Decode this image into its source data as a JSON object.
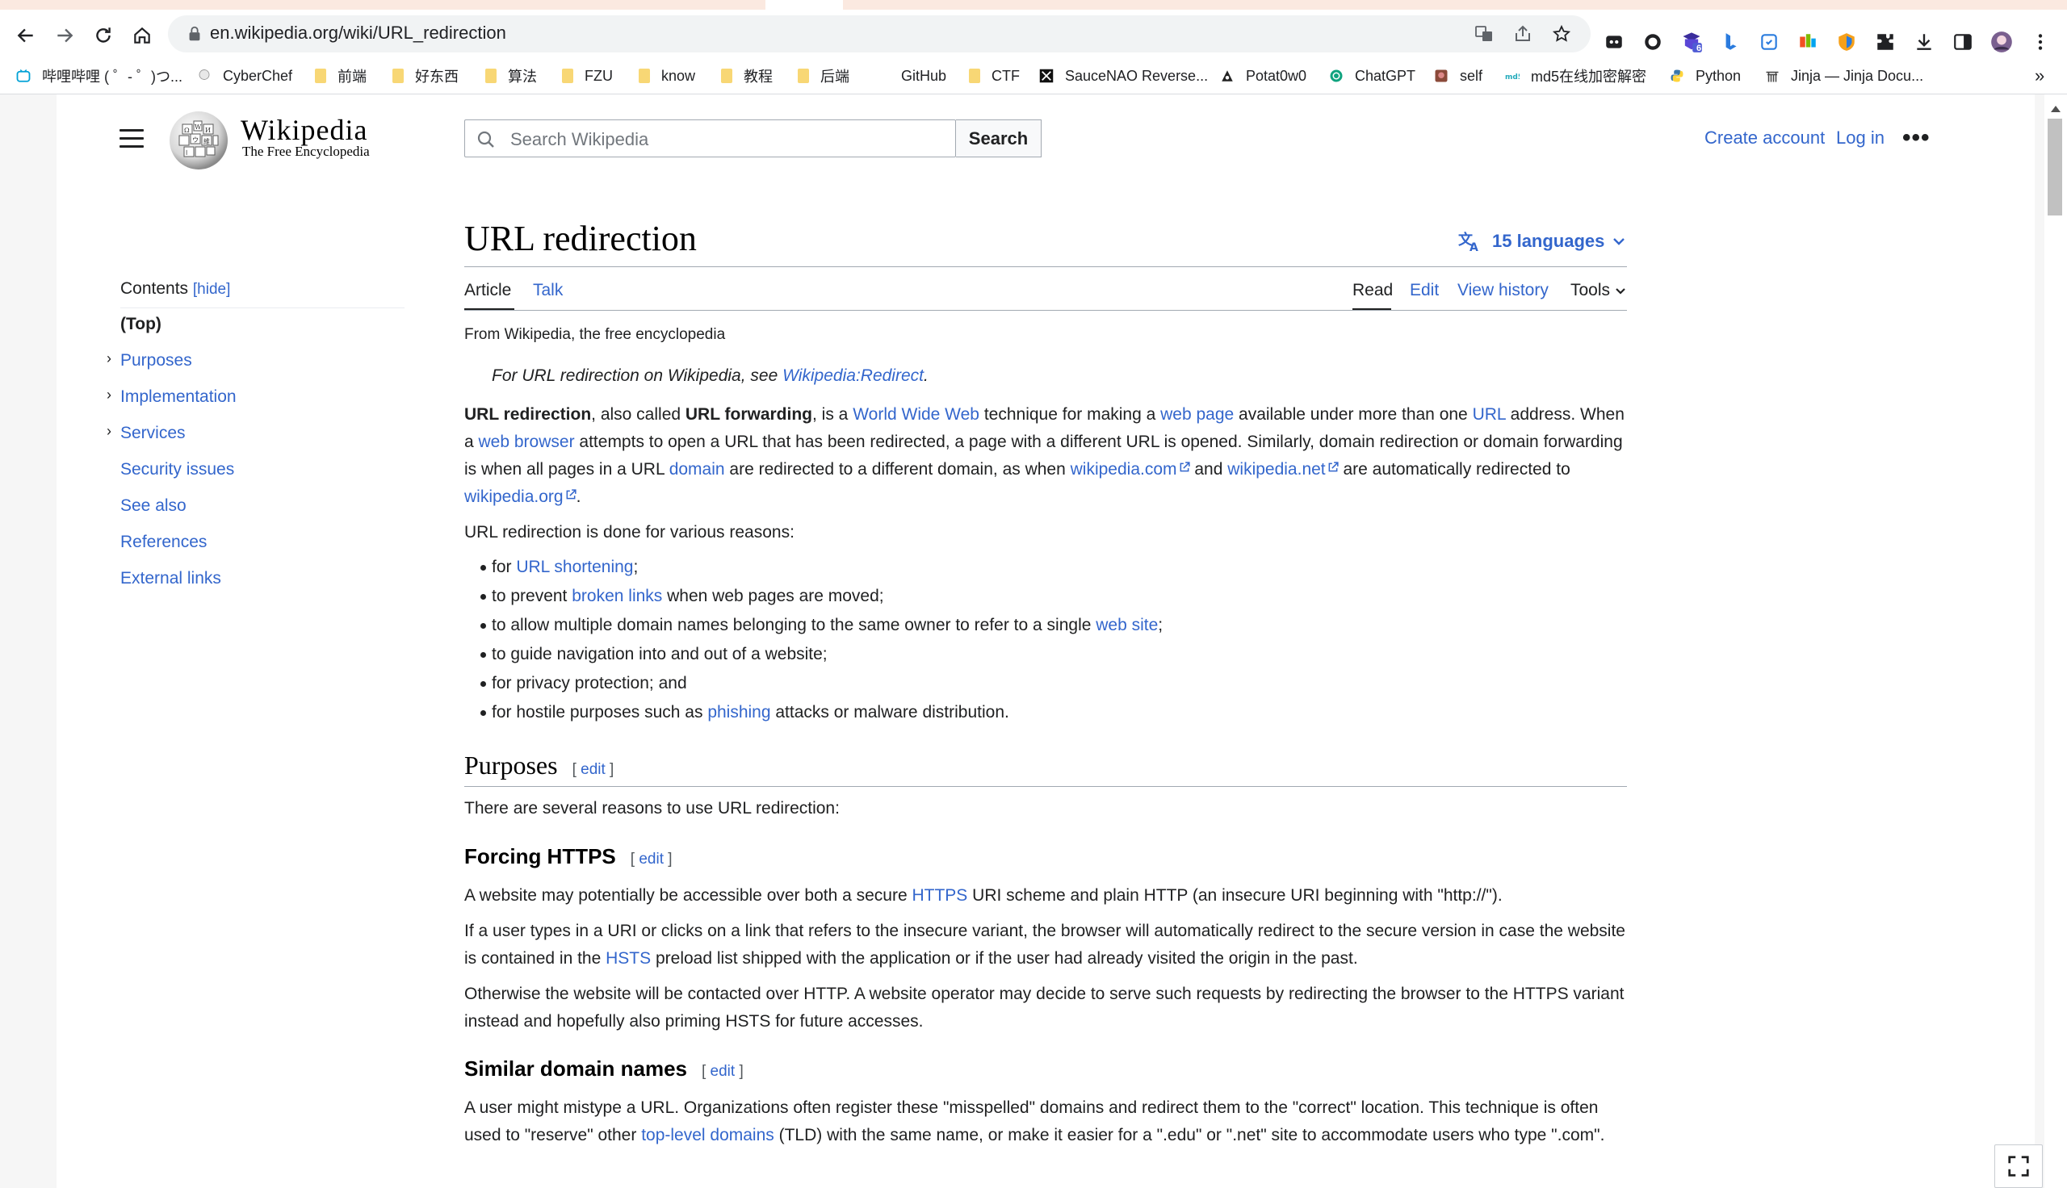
{
  "browser": {
    "url": "en.wikipedia.org/wiki/URL_redirection",
    "extension_badge": "6",
    "bookmarks": [
      {
        "label": "哔哩哔哩 ( ゜- ゜)つ...",
        "icon": "bilibili-icon"
      },
      {
        "label": "CyberChef",
        "icon": "cyberchef-icon"
      },
      {
        "label": "前端",
        "icon": "folder-icon"
      },
      {
        "label": "好东西",
        "icon": "folder-icon"
      },
      {
        "label": "算法",
        "icon": "folder-icon"
      },
      {
        "label": "FZU",
        "icon": "folder-icon"
      },
      {
        "label": "know",
        "icon": "folder-icon"
      },
      {
        "label": "教程",
        "icon": "folder-icon"
      },
      {
        "label": "后端",
        "icon": "folder-icon"
      },
      {
        "label": "GitHub",
        "icon": "github-icon"
      },
      {
        "label": "CTF",
        "icon": "folder-icon"
      },
      {
        "label": "SauceNAO Reverse...",
        "icon": "saucenao-icon"
      },
      {
        "label": "Potat0w0",
        "icon": "potato-icon"
      },
      {
        "label": "ChatGPT",
        "icon": "chatgpt-icon"
      },
      {
        "label": "self",
        "icon": "self-icon"
      },
      {
        "label": "md5在线加密解密",
        "icon": "md5-icon"
      },
      {
        "label": "Python",
        "icon": "python-icon"
      },
      {
        "label": "Jinja — Jinja Docu...",
        "icon": "jinja-icon"
      }
    ],
    "more_bookmarks": "»"
  },
  "header": {
    "wordmark": "Wikipedia",
    "tagline": "The Free Encyclopedia",
    "search_placeholder": "Search Wikipedia",
    "search_button": "Search",
    "create_account": "Create account",
    "log_in": "Log in",
    "more": "•••"
  },
  "title": "URL redirection",
  "languages": "15 languages",
  "tabs": {
    "article": "Article",
    "talk": "Talk",
    "read": "Read",
    "edit": "Edit",
    "history": "View history",
    "tools": "Tools"
  },
  "toc": {
    "heading": "Contents",
    "hide": "[hide]",
    "items": [
      "(Top)",
      "Purposes",
      "Implementation",
      "Services",
      "Security issues",
      "See also",
      "References",
      "External links"
    ]
  },
  "article": {
    "from": "From Wikipedia, the free encyclopedia",
    "hatnote_prefix": "For URL redirection on Wikipedia, see ",
    "hatnote_link": "Wikipedia:Redirect",
    "hatnote_suffix": ".",
    "intro": {
      "t1": "URL redirection",
      "t2": ", also called ",
      "t3": "URL forwarding",
      "t4": ", is a ",
      "l1": "World Wide Web",
      "t5": " technique for making a ",
      "l2": "web page",
      "t6": " available under more than one ",
      "l3": "URL",
      "t7": " address. When a ",
      "l4": "web browser",
      "t8": " attempts to open a URL that has been redirected, a page with a different URL is opened. Similarly, domain redirection or domain forwarding is when all pages in a URL ",
      "l5": "domain",
      "t9": " are redirected to a different domain, as when ",
      "l6": "wikipedia.com",
      "t10": " and ",
      "l7": "wikipedia.net",
      "t11": " are automatically redirected to ",
      "l8": "wikipedia.org",
      "t12": "."
    },
    "reasons_intro": "URL redirection is done for various reasons:",
    "reasons": [
      {
        "pre": "for ",
        "link": "URL shortening",
        "post": ";"
      },
      {
        "pre": "to prevent ",
        "link": "broken links",
        "post": " when web pages are moved;"
      },
      {
        "pre": "to allow multiple domain names belonging to the same owner to refer to a single ",
        "link": "web site",
        "post": ";"
      },
      {
        "pre": "to guide navigation into and out of a website;",
        "link": "",
        "post": ""
      },
      {
        "pre": "for privacy protection; and",
        "link": "",
        "post": ""
      },
      {
        "pre": "for hostile purposes such as ",
        "link": "phishing",
        "post": " attacks or malware distribution."
      }
    ],
    "purposes_heading": "Purposes",
    "edit_label": "edit",
    "purposes_intro": "There are several reasons to use URL redirection:",
    "https_heading": "Forcing HTTPS",
    "https_p1": {
      "pre": "A website may potentially be accessible over both a secure ",
      "link": "HTTPS",
      "post": " URI scheme and plain HTTP (an insecure URI beginning with \"http://\")."
    },
    "https_p2": {
      "pre": "If a user types in a URI or clicks on a link that refers to the insecure variant, the browser will automatically redirect to the secure version in case the website is contained in the ",
      "link": "HSTS",
      "post": " preload list shipped with the application or if the user had already visited the origin in the past."
    },
    "https_p3": "Otherwise the website will be contacted over HTTP. A website operator may decide to serve such requests by redirecting the browser to the HTTPS variant instead and hopefully also priming HSTS for future accesses.",
    "similar_heading": "Similar domain names",
    "similar_p1": {
      "pre": "A user might mistype a URL. Organizations often register these \"misspelled\" domains and redirect them to the \"correct\" location. This technique is often used to \"reserve\" other ",
      "link": "top-level domains",
      "post": " (TLD) with the same name, or make it easier for a \".edu\" or \".net\" site to accommodate users who type \".com\"."
    }
  }
}
